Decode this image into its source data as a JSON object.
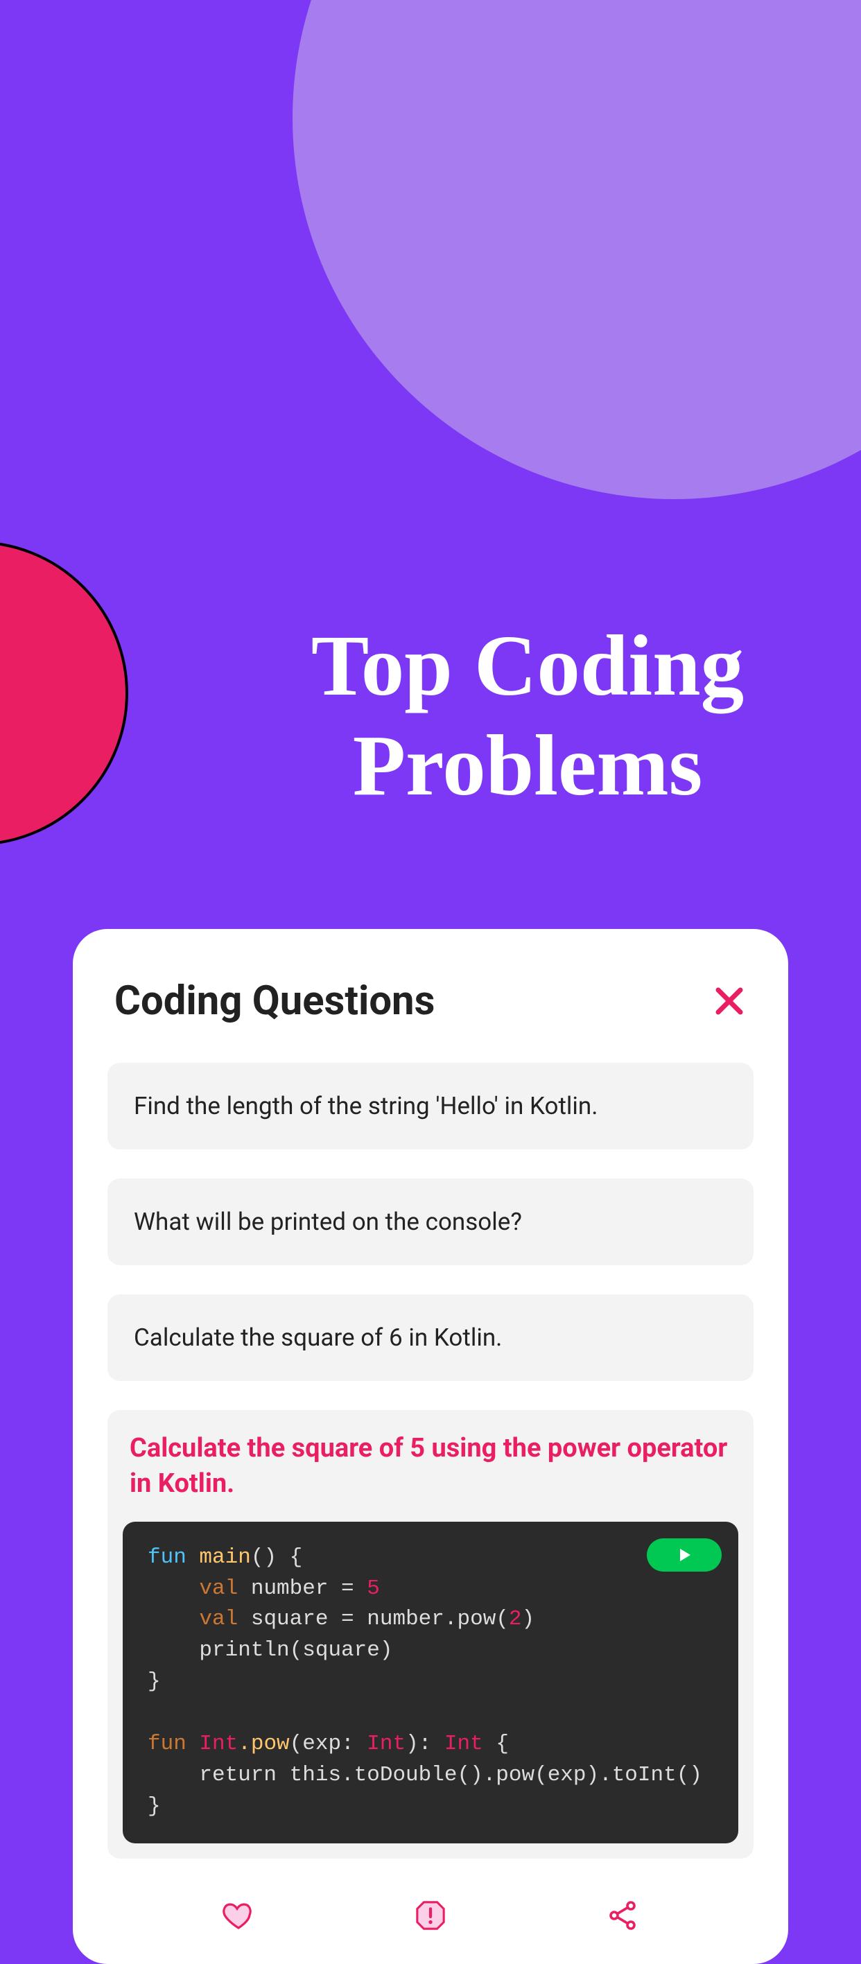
{
  "hero": {
    "title": "Top Coding Problems"
  },
  "card": {
    "title": "Coding Questions",
    "questions": [
      {
        "text": "Find the length of the string 'Hello' in Kotlin."
      },
      {
        "text": "What will be printed on the console?"
      },
      {
        "text": "Calculate the square of 6 in Kotlin."
      }
    ],
    "expanded": {
      "title": "Calculate the square of 5 using the power operator in Kotlin.",
      "code": {
        "l1_fun": "fun",
        "l1_main": "main",
        "l1_rest": "() {",
        "l2_val": "val",
        "l2_rest": " number = ",
        "l2_num": "5",
        "l3_val": "val",
        "l3_rest": " square = number.pow(",
        "l3_num": "2",
        "l3_close": ")",
        "l4": "    println(square)",
        "l5": "}",
        "l6": "",
        "l7_fun": "fun",
        "l7_type1": "Int",
        "l7_pow": ".pow",
        "l7_exp": "(exp: ",
        "l7_type2": "Int",
        "l7_paren": "): ",
        "l7_type3": "Int",
        "l7_brace": " {",
        "l8": "    return this.toDouble().pow(exp).toInt()",
        "l9": "}"
      }
    }
  },
  "icons": {
    "close": "close-icon",
    "run": "play-icon",
    "heart": "heart-icon",
    "report": "report-icon",
    "share": "share-icon"
  }
}
